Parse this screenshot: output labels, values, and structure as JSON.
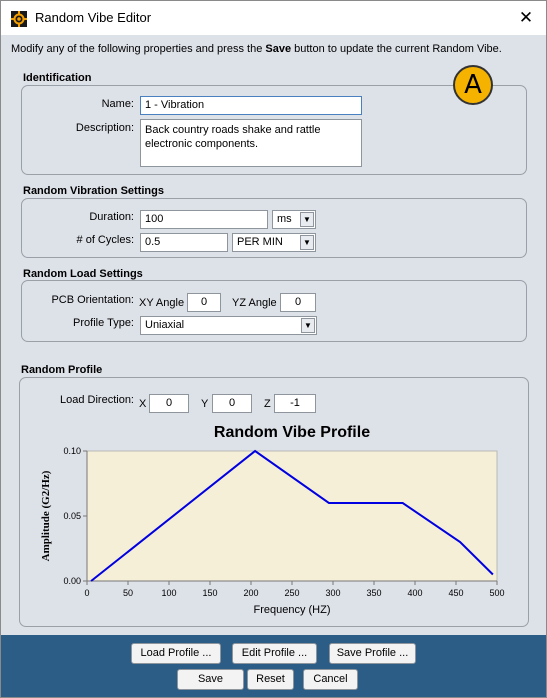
{
  "window": {
    "title": "Random Vibe Editor",
    "close_glyph": "✕"
  },
  "intro": {
    "before": "Modify any of the following properties and press the ",
    "bold": "Save",
    "after": " button to update the current Random Vibe."
  },
  "badge": {
    "text": "A",
    "color": "#f5b300"
  },
  "identification": {
    "title": "Identification",
    "name_label": "Name:",
    "name_value": "1 - Vibration",
    "description_label": "Description:",
    "description_value": "Back country roads shake and rattle electronic components."
  },
  "vibration_settings": {
    "title": "Random Vibration Settings",
    "duration_label": "Duration:",
    "duration_value": "100",
    "duration_unit": "ms",
    "cycles_label": "# of Cycles:",
    "cycles_value": "0.5",
    "cycles_unit": "PER MIN"
  },
  "load_settings": {
    "title": "Random Load Settings",
    "pcb_label": "PCB Orientation:",
    "xy_label": "XY Angle",
    "xy_value": "0",
    "yz_label": "YZ Angle",
    "yz_value": "0",
    "profile_type_label": "Profile Type:",
    "profile_type_value": "Uniaxial"
  },
  "random_profile": {
    "title": "Random Profile",
    "load_direction_label": "Load Direction:",
    "x_label": "X",
    "x_value": "0",
    "y_label": "Y",
    "y_value": "0",
    "z_label": "Z",
    "z_value": "-1"
  },
  "chart_data": {
    "type": "line",
    "title": "Random Vibe Profile",
    "xlabel": "Frequency (HZ)",
    "ylabel": "Amplitude (G2/Hz)",
    "xlim": [
      0,
      500
    ],
    "ylim": [
      0,
      0.1
    ],
    "xticks": [
      "0",
      "50",
      "100",
      "150",
      "200",
      "250",
      "300",
      "350",
      "400",
      "450",
      "500"
    ],
    "yticks": [
      "0.00",
      "0.05",
      "0.10"
    ],
    "grid": false,
    "plot_background": "#f6efd8",
    "series_color": "#0000e0",
    "series": [
      {
        "x": [
          5,
          205,
          295,
          385,
          455,
          495
        ],
        "y": [
          0.0,
          0.1,
          0.06,
          0.06,
          0.03,
          0.005
        ]
      }
    ]
  },
  "buttons": {
    "load_profile": "Load Profile ...",
    "edit_profile": "Edit Profile ...",
    "save_profile": "Save Profile ...",
    "save": "Save",
    "reset": "Reset",
    "cancel": "Cancel"
  },
  "colors": {
    "footer": "#2c5d86",
    "panel": "#dde1e8"
  }
}
